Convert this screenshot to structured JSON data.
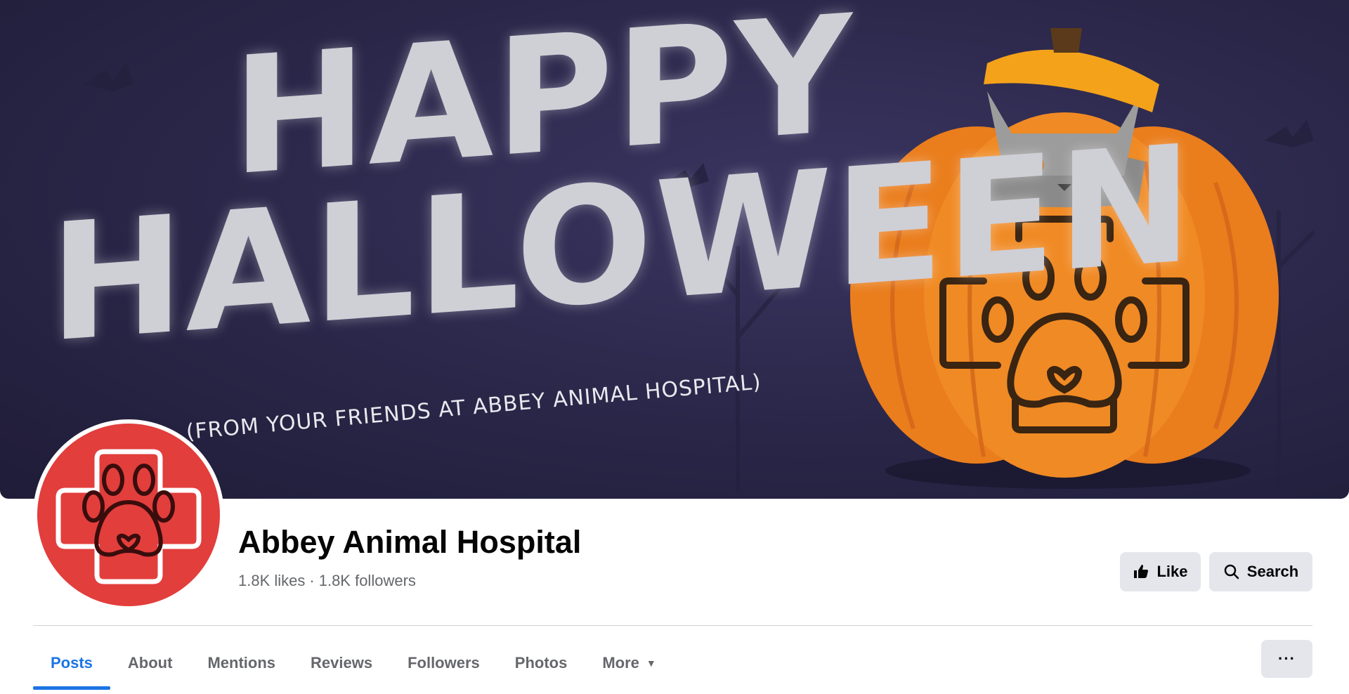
{
  "cover": {
    "headline_line1": "Happy",
    "headline_line2": "Halloween",
    "subline": "(From your friends at Abbey Animal Hospital)",
    "bg_color": "#2a2648",
    "pumpkin_color": "#f08a24",
    "logo_color": "#e23e3c"
  },
  "profile": {
    "name": "Abbey Animal Hospital",
    "likes": "1.8K likes",
    "separator": "·",
    "followers": "1.8K followers"
  },
  "actions": {
    "like_label": "Like",
    "like_icon": "thumbs-up-icon",
    "search_label": "Search",
    "search_icon": "search-icon",
    "more_label": "···"
  },
  "tabs": [
    {
      "label": "Posts",
      "active": true
    },
    {
      "label": "About"
    },
    {
      "label": "Mentions"
    },
    {
      "label": "Reviews"
    },
    {
      "label": "Followers"
    },
    {
      "label": "Photos"
    },
    {
      "label": "More",
      "icon": "caret-down-icon"
    }
  ]
}
